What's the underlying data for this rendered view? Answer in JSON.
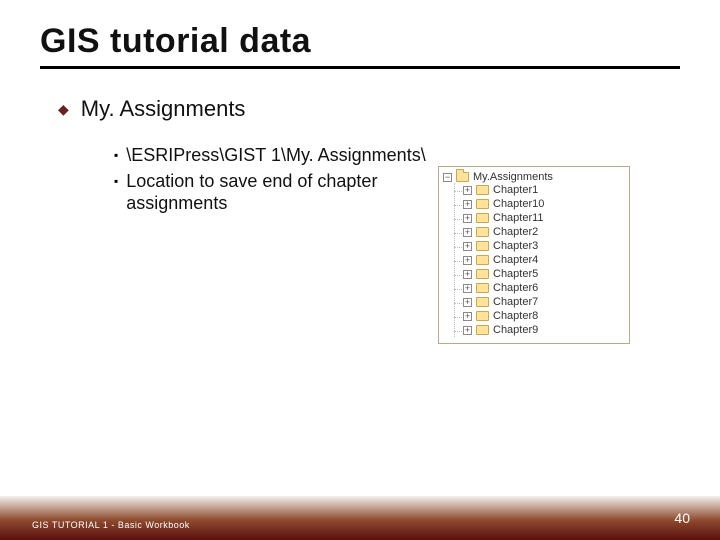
{
  "title": "GIS tutorial data",
  "main_bullet": "My. Assignments",
  "sub_bullets": [
    "\\ESRIPress\\GIST 1\\My. Assignments\\",
    "Location to save end of chapter assignments"
  ],
  "tree": {
    "root_label": "My.Assignments",
    "root_toggle": "−",
    "children": [
      {
        "label": "Chapter1",
        "toggle": "+"
      },
      {
        "label": "Chapter10",
        "toggle": "+"
      },
      {
        "label": "Chapter11",
        "toggle": "+"
      },
      {
        "label": "Chapter2",
        "toggle": "+"
      },
      {
        "label": "Chapter3",
        "toggle": "+"
      },
      {
        "label": "Chapter4",
        "toggle": "+"
      },
      {
        "label": "Chapter5",
        "toggle": "+"
      },
      {
        "label": "Chapter6",
        "toggle": "+"
      },
      {
        "label": "Chapter7",
        "toggle": "+"
      },
      {
        "label": "Chapter8",
        "toggle": "+"
      },
      {
        "label": "Chapter9",
        "toggle": "+"
      }
    ]
  },
  "footer": "GIS TUTORIAL 1 - Basic Workbook",
  "page_number": "40"
}
